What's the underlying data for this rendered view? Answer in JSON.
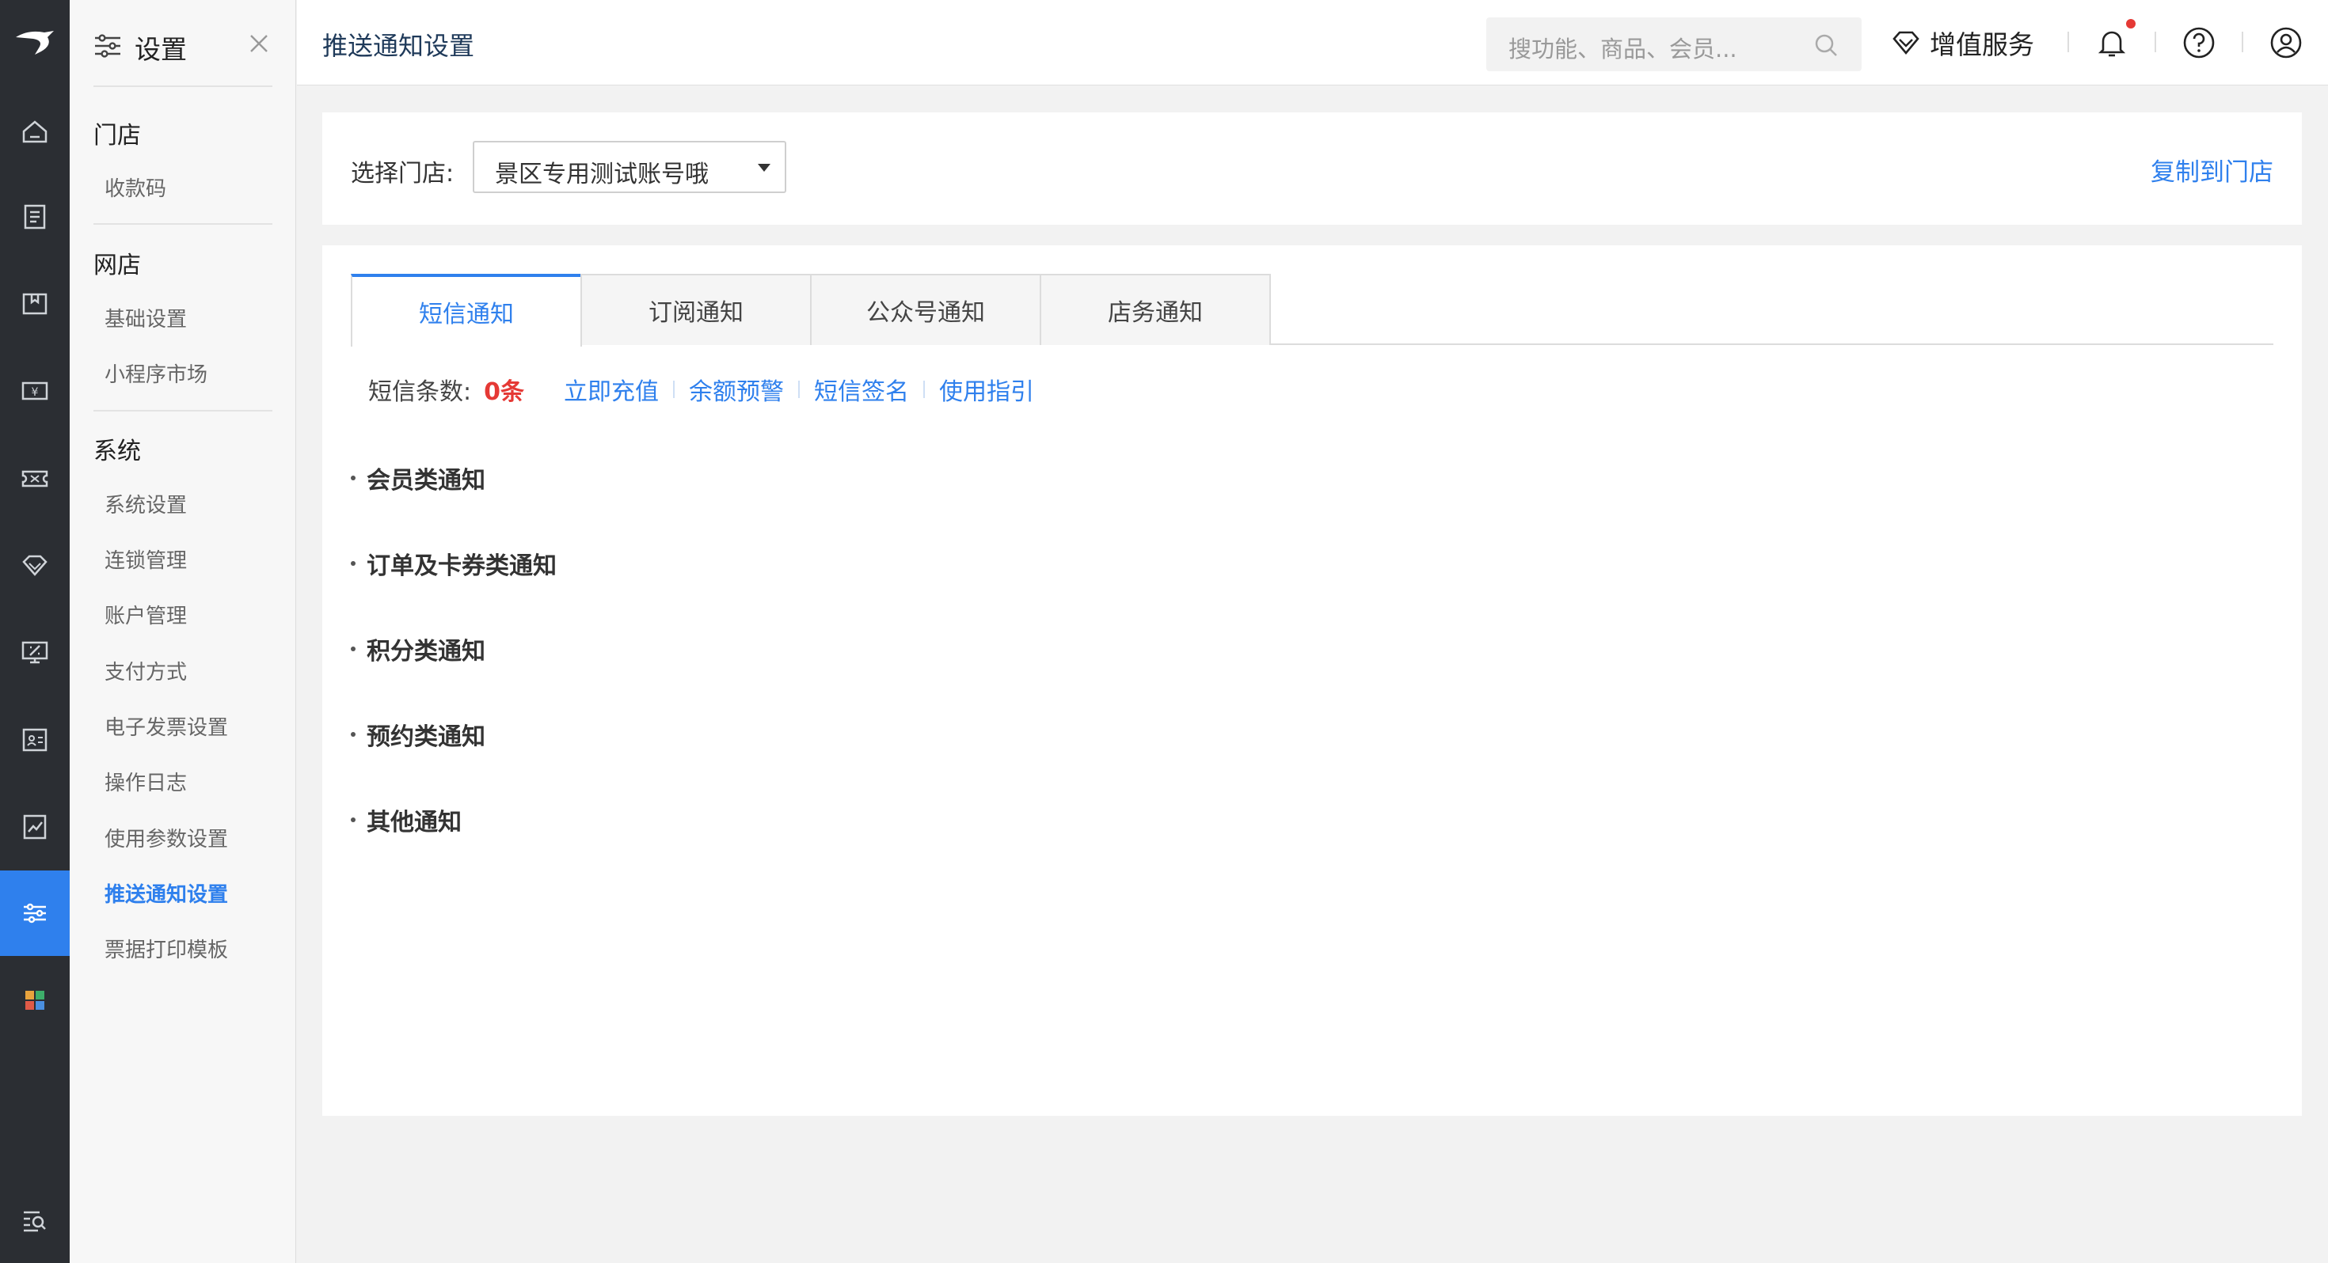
{
  "sidebar": {
    "title": "设置",
    "groups": [
      {
        "label": "门店",
        "items": [
          "收款码"
        ]
      },
      {
        "label": "网店",
        "items": [
          "基础设置",
          "小程序市场"
        ]
      },
      {
        "label": "系统",
        "items": [
          "系统设置",
          "连锁管理",
          "账户管理",
          "支付方式",
          "电子发票设置",
          "操作日志",
          "使用参数设置",
          "推送通知设置",
          "票据打印模板"
        ]
      }
    ],
    "active_item": "推送通知设置"
  },
  "rail": {
    "icons": [
      "logo-icon",
      "home-icon",
      "order-book-icon",
      "goods-box-icon",
      "cashier-icon",
      "coupon-icon",
      "membership-gem-icon",
      "marketing-screen-icon",
      "member-card-icon",
      "report-chart-icon",
      "settings-sliders-icon",
      "apps-grid-icon",
      "search-menu-icon"
    ],
    "active": "settings-sliders-icon"
  },
  "header": {
    "page_title": "推送通知设置",
    "search_placeholder": "搜功能、商品、会员...",
    "value_added_label": "增值服务",
    "icons": [
      "search-icon",
      "diamond-icon",
      "bell-icon",
      "help-icon",
      "user-icon"
    ]
  },
  "store": {
    "label": "选择门店:",
    "selected": "景区专用测试账号哦",
    "copy_label": "复制到门店"
  },
  "tabs": [
    {
      "label": "短信通知",
      "active": true
    },
    {
      "label": "订阅通知",
      "active": false
    },
    {
      "label": "公众号通知",
      "active": false
    },
    {
      "label": "店务通知",
      "active": false
    }
  ],
  "sms": {
    "count_label": "短信条数:",
    "count_value": "0条",
    "links": [
      "立即充值",
      "余额预警",
      "短信签名",
      "使用指引"
    ]
  },
  "categories": [
    "会员类通知",
    "订单及卡券类通知",
    "积分类通知",
    "预约类通知",
    "其他通知"
  ],
  "colors": {
    "accent": "#2f80ed",
    "rail_bg": "#2b2e33",
    "alert": "#e53935"
  }
}
